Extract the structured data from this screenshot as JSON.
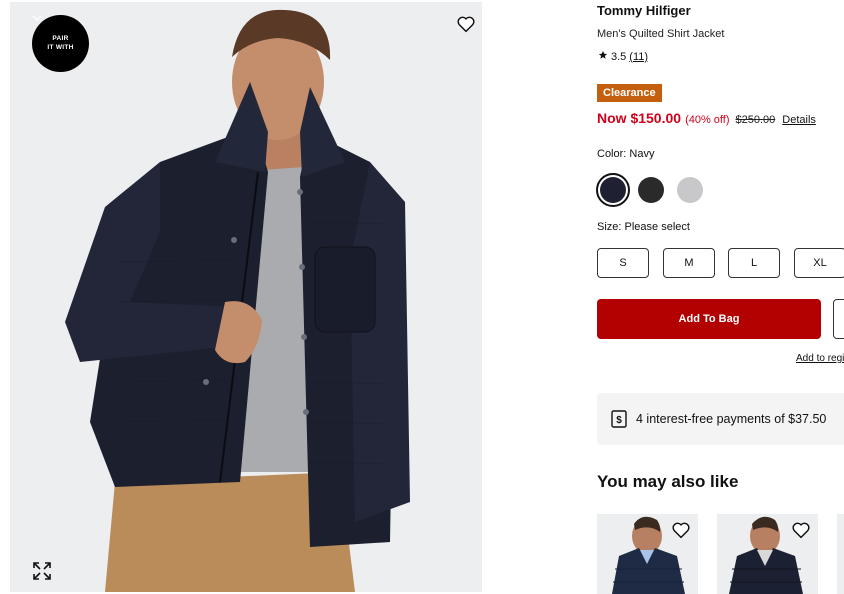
{
  "gallery": {
    "pair_badge": {
      "line1": "PAIR",
      "line2": "IT WITH"
    },
    "icons": {
      "wishlist": "heart-icon",
      "expand": "expand-icon",
      "pair_chevron": "chevron-down-icon"
    }
  },
  "product": {
    "brand": "Tommy Hilfiger",
    "name": "Men's Quilted Shirt Jacket",
    "rating": {
      "value": "3.5",
      "count": "(11)",
      "icon": "star-icon"
    },
    "badge": "Clearance",
    "price": {
      "now": "Now $150.00",
      "discount": "(40% off)",
      "was": "$250.00",
      "details": "Details"
    },
    "color": {
      "label": "Color: Navy",
      "swatches": [
        {
          "name": "Navy",
          "hex": "#1f2133",
          "selected": true
        },
        {
          "name": "Black",
          "hex": "#2a2a2a",
          "selected": false
        },
        {
          "name": "Grey",
          "hex": "#c8c8ca",
          "selected": false
        }
      ]
    },
    "size": {
      "label": "Size: Please select",
      "options": [
        "S",
        "M",
        "L",
        "XL"
      ]
    },
    "add_to_bag": "Add To Bag",
    "registry_link": "Add to regi",
    "installments": {
      "text": "4 interest-free payments of $37.50",
      "icon": "dollar-card-icon"
    }
  },
  "recommendations": {
    "title": "You may also like",
    "items": [
      {
        "name": "puffer-jacket-1",
        "wishlist_icon": "heart-icon"
      },
      {
        "name": "puffer-jacket-2",
        "wishlist_icon": "heart-icon"
      }
    ]
  },
  "colors": {
    "clearance": "#c45f0f",
    "sale_red": "#d0021b",
    "add_to_bag": "#b30000"
  }
}
